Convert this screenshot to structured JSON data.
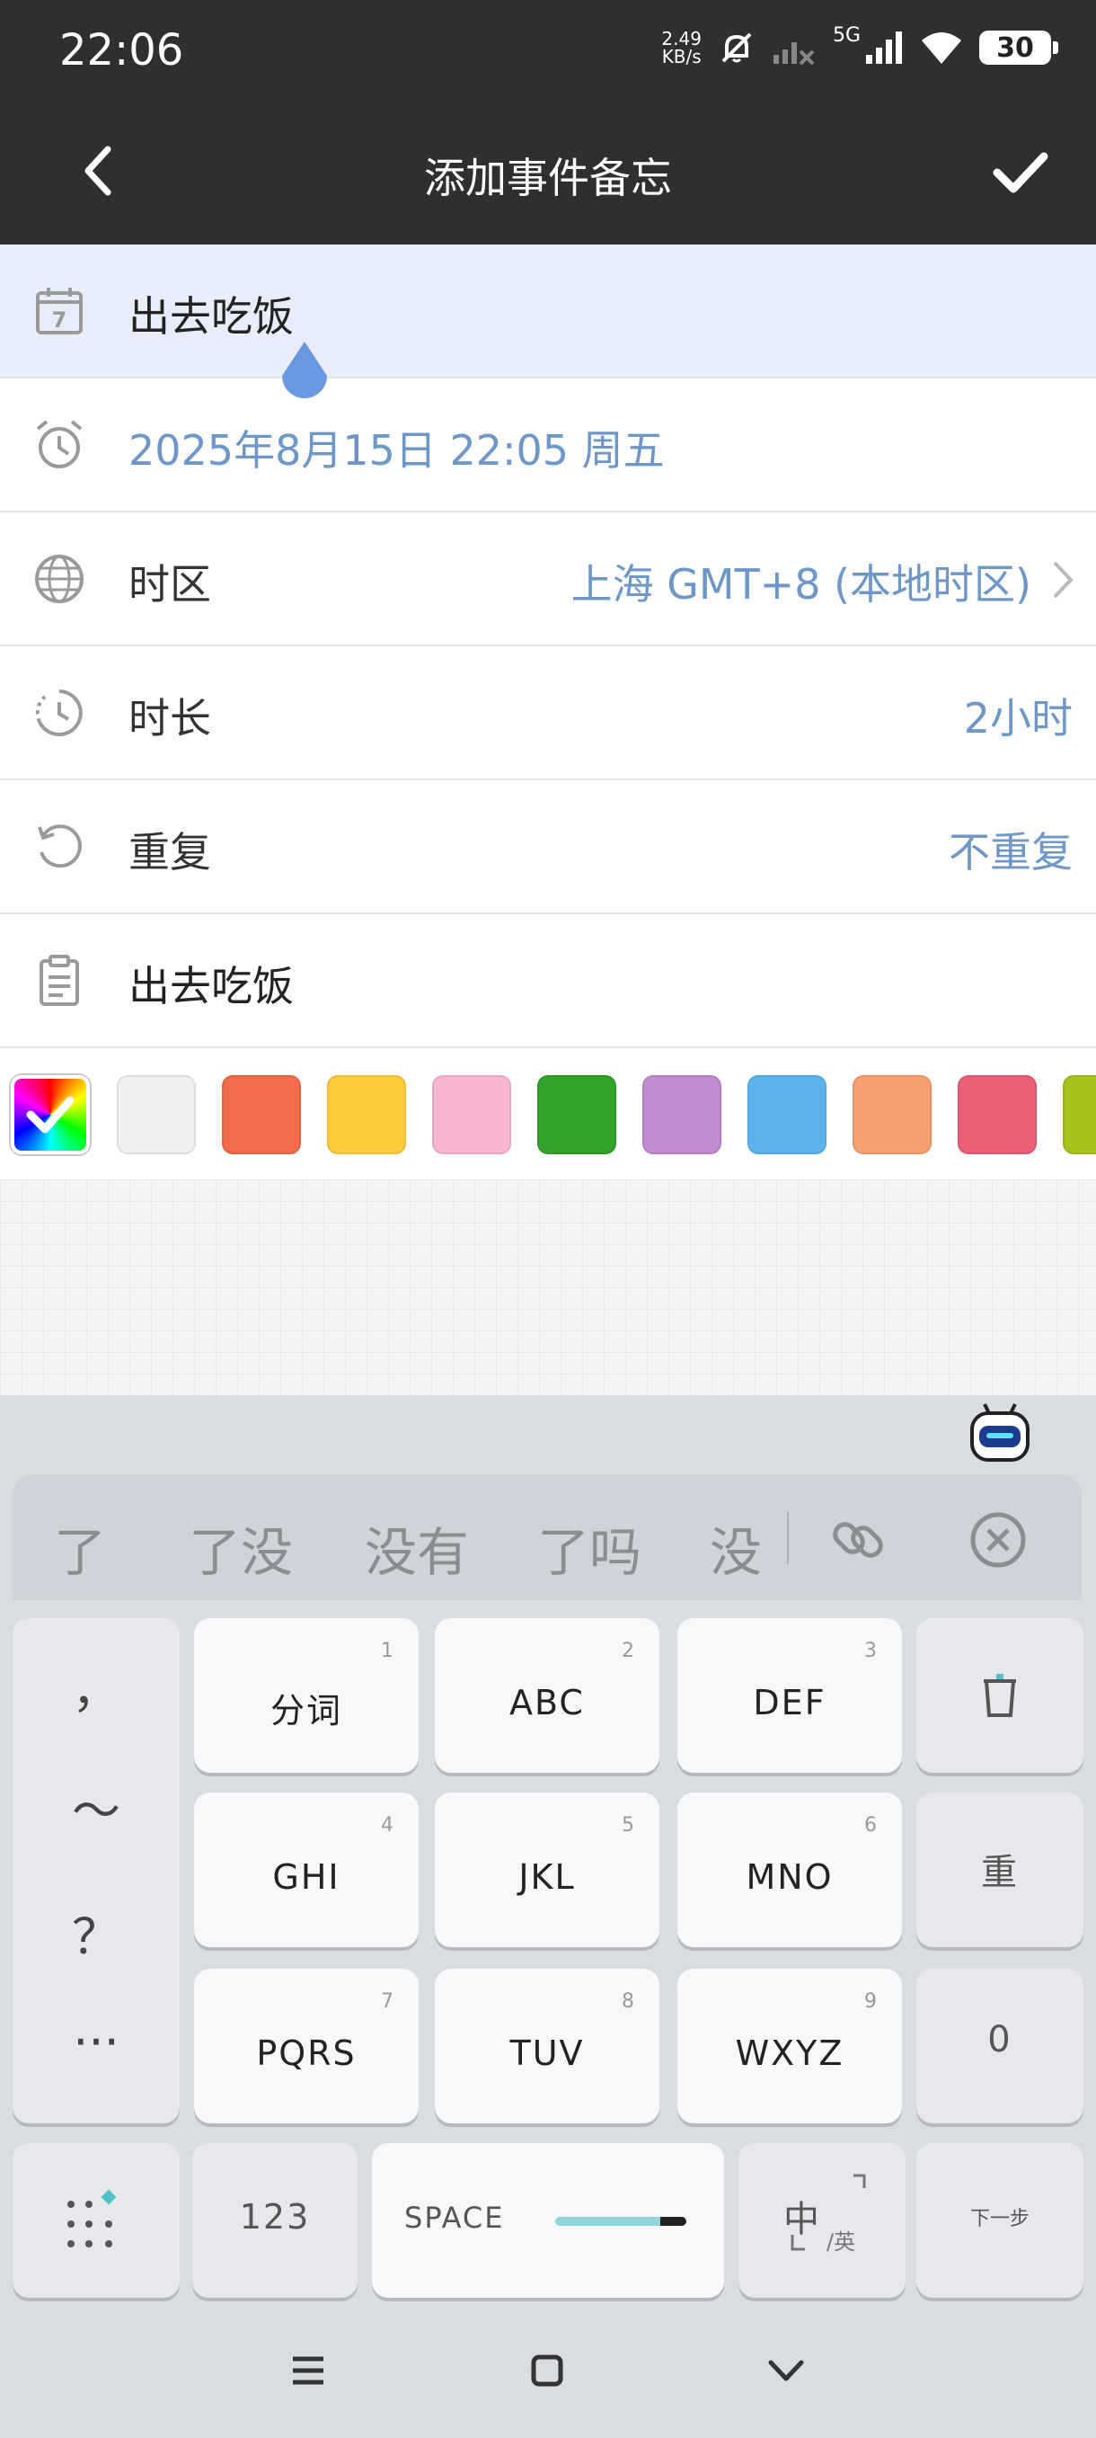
{
  "status_bar": {
    "time": "22:06",
    "speed_top": "2.49",
    "speed_bottom": "KB/s",
    "network": "5G",
    "battery": "30"
  },
  "header": {
    "title": "添加事件备忘"
  },
  "rows": {
    "event": {
      "value": "出去吃饭",
      "icon": "calendar-icon"
    },
    "datetime": {
      "value": "2025年8月15日 22:05 周五",
      "icon": "alarm-clock-icon"
    },
    "timezone": {
      "label": "时区",
      "value": "上海 GMT+8 (本地时区)",
      "icon": "globe-icon"
    },
    "duration": {
      "label": "时长",
      "value": "2小时",
      "icon": "duration-icon"
    },
    "repeat": {
      "label": "重复",
      "value": "不重复",
      "icon": "repeat-icon"
    },
    "note": {
      "value": "出去吃饭",
      "icon": "clipboard-icon"
    }
  },
  "colors": [
    "#f0f0f0",
    "#f26b4a",
    "#fccb3a",
    "#f9b5d2",
    "#34a32c",
    "#c28ad0",
    "#5cb3ec",
    "#f7a070",
    "#ee5f78",
    "#a7c21a"
  ],
  "keyboard": {
    "candidates": [
      "了",
      "了没",
      "没有",
      "了吗",
      "没"
    ],
    "punctuation": [
      "，",
      "～",
      "？",
      "···"
    ],
    "keys": [
      {
        "num": "1",
        "label": "分词"
      },
      {
        "num": "2",
        "label": "ABC"
      },
      {
        "num": "3",
        "label": "DEF"
      },
      {
        "num": "4",
        "label": "GHI"
      },
      {
        "num": "5",
        "label": "JKL"
      },
      {
        "num": "6",
        "label": "MNO"
      },
      {
        "num": "7",
        "label": "PQRS"
      },
      {
        "num": "8",
        "label": "TUV"
      },
      {
        "num": "9",
        "label": "WXYZ"
      }
    ],
    "side_keys": {
      "reenter": "重",
      "zero": "0"
    },
    "bottom": {
      "numbers": "123",
      "space": "SPACE",
      "lang_main": "中",
      "lang_sub": "/英",
      "next": "下一步"
    }
  }
}
